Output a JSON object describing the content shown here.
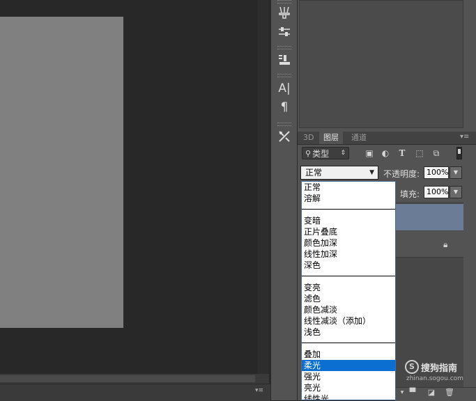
{
  "layers_panel": {
    "tabs": [
      "3D",
      "图层",
      "通道"
    ],
    "filter_label": "类型",
    "blend_mode_current": "正常",
    "opacity_label": "不透明度:",
    "opacity_value": "100%",
    "fill_label": "填充:",
    "fill_value": "100%"
  },
  "blend_modes": {
    "group1": [
      "正常",
      "溶解"
    ],
    "group2": [
      "变暗",
      "正片叠底",
      "颜色加深",
      "线性加深",
      "深色"
    ],
    "group3": [
      "变亮",
      "滤色",
      "颜色减淡",
      "线性减淡（添加）",
      "浅色"
    ],
    "group4": [
      "叠加",
      "柔光",
      "强光",
      "亮光",
      "线性光"
    ],
    "selected": "柔光"
  },
  "icons": {
    "tools": [
      "brush-presets-icon",
      "adjustments-icon",
      "clone-source-icon",
      "character-icon",
      "paragraph-icon",
      "tool-presets-icon"
    ],
    "filters": [
      "image-filter-icon",
      "adjustment-filter-icon",
      "type-filter-icon",
      "shape-filter-icon",
      "smart-object-filter-icon"
    ],
    "footer": [
      "folder-icon",
      "new-layer-icon",
      "trash-icon"
    ]
  },
  "watermark": {
    "text": "搜狗指南",
    "url": "zhinan.sogou.com"
  },
  "colors": {
    "selected_option": "#0a6fd0",
    "selected_layer": "#6a7c96",
    "panel_bg": "#535353"
  }
}
